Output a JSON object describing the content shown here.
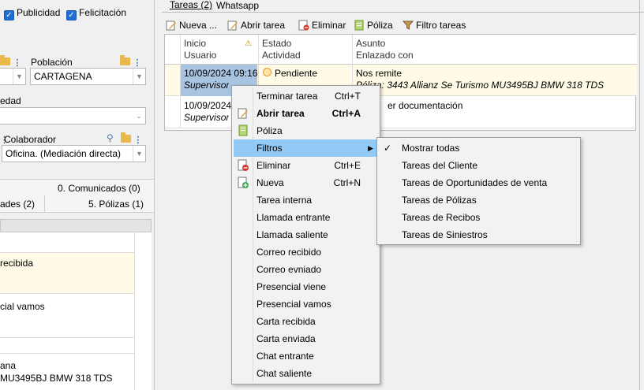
{
  "left_panel": {
    "check_publicidad": "Publicidad",
    "check_felicitacion": "Felicitación",
    "poblacion_label": "Población",
    "poblacion_value": "CARTAGENA",
    "edad_label": "edad",
    "colaborador_label": "Colaborador",
    "colaborador_value": "Oficina. (Mediación directa)",
    "tab_comunicados": "0. Comunicados (0)",
    "tab_ades": "ades (2)",
    "tab_polizas": "5. Pólizas (1)",
    "list_items": [
      {
        "line1": "recibida",
        "line2": ""
      },
      {
        "line1": "cial vamos",
        "line2": ""
      },
      {
        "line1": "ana",
        "line2": "MU3495BJ BMW 318 TDS"
      }
    ]
  },
  "tabs": {
    "tareas": "Tareas (2)",
    "whatsapp": "Whatsapp"
  },
  "toolbar": {
    "nueva": "Nueva ...",
    "abrir": "Abrir tarea",
    "eliminar": "Eliminar",
    "poliza": "Póliza",
    "filtro": "Filtro tareas"
  },
  "grid": {
    "headers": {
      "inicio": "Inicio",
      "usuario": "Usuario",
      "estado": "Estado",
      "actividad": "Actividad",
      "asunto": "Asunto",
      "enlazado": "Enlazado con"
    },
    "rows": [
      {
        "fecha": "10/09/2024 09:16",
        "usuario": "Supervisor",
        "estado": "Pendiente",
        "asunto": "Nos remite",
        "enlazado": "Póliza: 3443 Allianz Se Turismo MU3495BJ BMW 318 TDS"
      },
      {
        "fecha": "10/09/2024",
        "usuario": "Supervisor",
        "estado": "",
        "asunto": "er documentación",
        "enlazado": ""
      }
    ]
  },
  "context_menu": {
    "items": [
      {
        "label": "Terminar tarea",
        "shortcut": "Ctrl+T",
        "icon": ""
      },
      {
        "label": "Abrir tarea",
        "shortcut": "Ctrl+A",
        "icon": "edit-icon"
      },
      {
        "label": "Póliza",
        "shortcut": "",
        "icon": "policy-icon"
      },
      {
        "label": "Filtros",
        "shortcut": "",
        "icon": ""
      },
      {
        "label": "Eliminar",
        "shortcut": "Ctrl+E",
        "icon": "delete-icon"
      },
      {
        "label": "Nueva",
        "shortcut": "Ctrl+N",
        "icon": "new-icon"
      },
      {
        "label": "Tarea interna",
        "shortcut": "",
        "icon": ""
      },
      {
        "label": "Llamada entrante",
        "shortcut": "",
        "icon": ""
      },
      {
        "label": "Llamada saliente",
        "shortcut": "",
        "icon": ""
      },
      {
        "label": "Correo recibido",
        "shortcut": "",
        "icon": ""
      },
      {
        "label": "Correo evniado",
        "shortcut": "",
        "icon": ""
      },
      {
        "label": "Presencial viene",
        "shortcut": "",
        "icon": ""
      },
      {
        "label": "Presencial vamos",
        "shortcut": "",
        "icon": ""
      },
      {
        "label": "Carta recibida",
        "shortcut": "",
        "icon": ""
      },
      {
        "label": "Carta enviada",
        "shortcut": "",
        "icon": ""
      },
      {
        "label": "Chat entrante",
        "shortcut": "",
        "icon": ""
      },
      {
        "label": "Chat saliente",
        "shortcut": "",
        "icon": ""
      }
    ]
  },
  "submenu": {
    "items": [
      {
        "label": "Mostrar todas",
        "checked": true
      },
      {
        "label": "Tareas del Cliente",
        "checked": false
      },
      {
        "label": "Tareas de Oportunidades de venta",
        "checked": false
      },
      {
        "label": "Tareas de Pólizas",
        "checked": false
      },
      {
        "label": "Tareas de Recibos",
        "checked": false
      },
      {
        "label": "Tareas de Siniestros",
        "checked": false
      }
    ]
  },
  "colors": {
    "highlight": "#91c9f7",
    "selected_row": "#fffbe6",
    "accent": "#1e6fd1"
  }
}
